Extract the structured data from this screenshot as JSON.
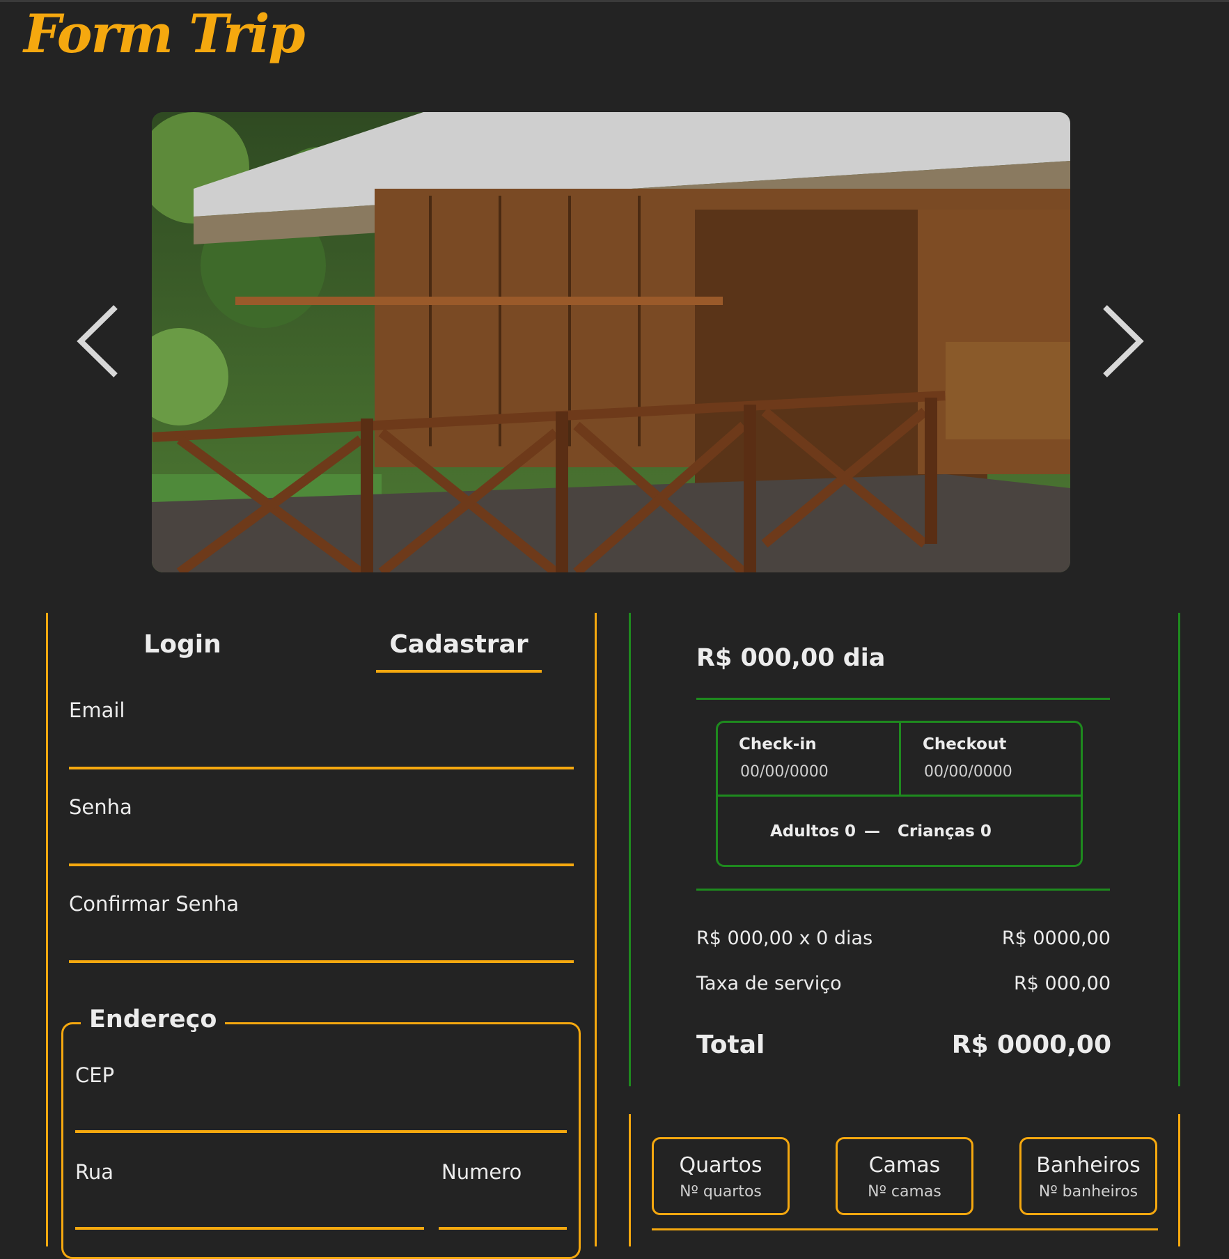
{
  "brand": {
    "logo": "Form Trip",
    "accent": "#f5a80f",
    "green": "#1e8a1e",
    "background": "#232323"
  },
  "carousel": {
    "prev_icon": "chevron-left-icon",
    "next_icon": "chevron-right-icon"
  },
  "auth": {
    "tabs": [
      {
        "label": "Login",
        "active": false
      },
      {
        "label": "Cadastrar",
        "active": true
      }
    ],
    "fields": {
      "email": {
        "label": "Email",
        "value": ""
      },
      "senha": {
        "label": "Senha",
        "value": ""
      },
      "confirmar": {
        "label": "Confirmar Senha",
        "value": ""
      }
    },
    "address": {
      "title": "Endereço",
      "cep": {
        "label": "CEP",
        "value": ""
      },
      "rua": {
        "label": "Rua",
        "value": ""
      },
      "numero": {
        "label": "Numero",
        "value": ""
      }
    }
  },
  "booking": {
    "price_per_day": "R$ 000,00 dia",
    "checkin": {
      "label": "Check-in",
      "value": "00/00/0000"
    },
    "checkout": {
      "label": "Checkout",
      "value": "00/00/0000"
    },
    "adults": "Adultos 0",
    "separator": "—",
    "children": "Crianças 0",
    "line_items": [
      {
        "label": "R$ 000,00 x 0 dias",
        "value": "R$ 0000,00"
      },
      {
        "label": "Taxa de serviço",
        "value": "R$ 000,00"
      }
    ],
    "total_label": "Total",
    "total_value": "R$ 0000,00"
  },
  "features": [
    {
      "title": "Quartos",
      "sub": "Nº quartos"
    },
    {
      "title": "Camas",
      "sub": "Nº camas"
    },
    {
      "title": "Banheiros",
      "sub": "Nº banheiros"
    }
  ]
}
